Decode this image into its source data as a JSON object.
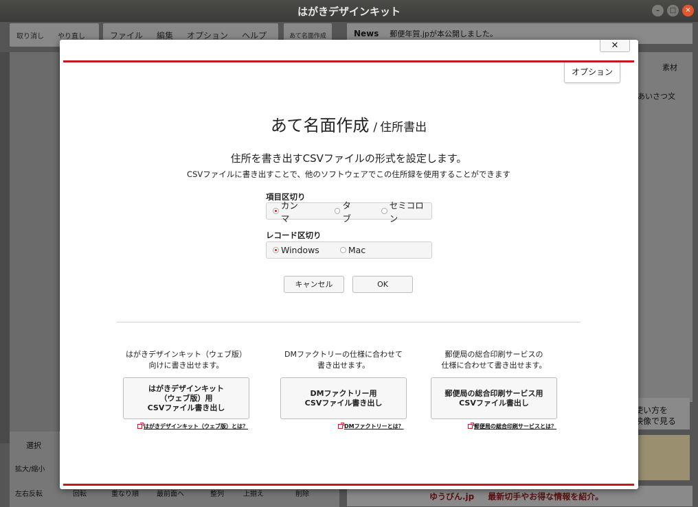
{
  "window": {
    "title": "はがきデザインキット"
  },
  "background_app": {
    "toolbar": {
      "undo": "取り消し",
      "redo": "やり直し",
      "menus": [
        "ファイル",
        "編集",
        "オプション",
        "ヘルプ"
      ],
      "address_side": "あて名面作成"
    },
    "news": {
      "label": "News",
      "text": "郵便年賀.jpが本公開しました。"
    },
    "right_panel": {
      "material": "素材",
      "greeting": "あいさつ文"
    },
    "video_ad": "使い方を\n映像で見る",
    "bottom_tools": {
      "select": "選択",
      "zoom": "拡大/縮小",
      "flip": "左右反転",
      "rotate": "回転",
      "layer": "重なり順",
      "layer_value": "最前面へ",
      "align": "整列",
      "align_value": "上揃え",
      "delete": "削除"
    },
    "bottom_banner": {
      "brand": "ゆうびん.jp",
      "text": "最新切手やお得な情報を紹介。"
    }
  },
  "dialog": {
    "close_glyph": "✕",
    "options_button": "オプション",
    "title_main": "あて名面作成",
    "title_sep": "/",
    "title_sub": "住所書出",
    "lead": "住所を書き出すCSVファイルの形式を設定します。",
    "description": "CSVファイルに書き出すことで、他のソフトウェアでこの住所録を使用することができます",
    "field_delimiter": {
      "label": "項目区切り",
      "options": [
        "カンマ",
        "タブ",
        "セミコロン"
      ],
      "selected": "カンマ"
    },
    "record_delimiter": {
      "label": "レコード区切り",
      "options": [
        "Windows",
        "Mac"
      ],
      "selected": "Windows"
    },
    "cancel_button": "キャンセル",
    "ok_button": "OK",
    "export_options": [
      {
        "description": "はがきデザインキット（ウェブ版）\n向けに書き出せます。",
        "button": "はがきデザインキット\n（ウェブ版）用\nCSVファイル書き出し",
        "link": "はがきデザインキット（ウェブ版）とは？"
      },
      {
        "description": "DMファクトリーの仕様に合わせて\n書き出せます。",
        "button": "DMファクトリー用\nCSVファイル書き出し",
        "link": "DMファクトリーとは？"
      },
      {
        "description": "郵便局の総合印刷サービスの\n仕様に合わせて書き出せます。",
        "button": "郵便局の総合印刷サービス用\nCSVファイル書出し",
        "link": "郵便局の総合印刷サービスとは？"
      }
    ]
  },
  "colors": {
    "accent": "#c8161d",
    "titlebar": "#3f3f3d"
  }
}
